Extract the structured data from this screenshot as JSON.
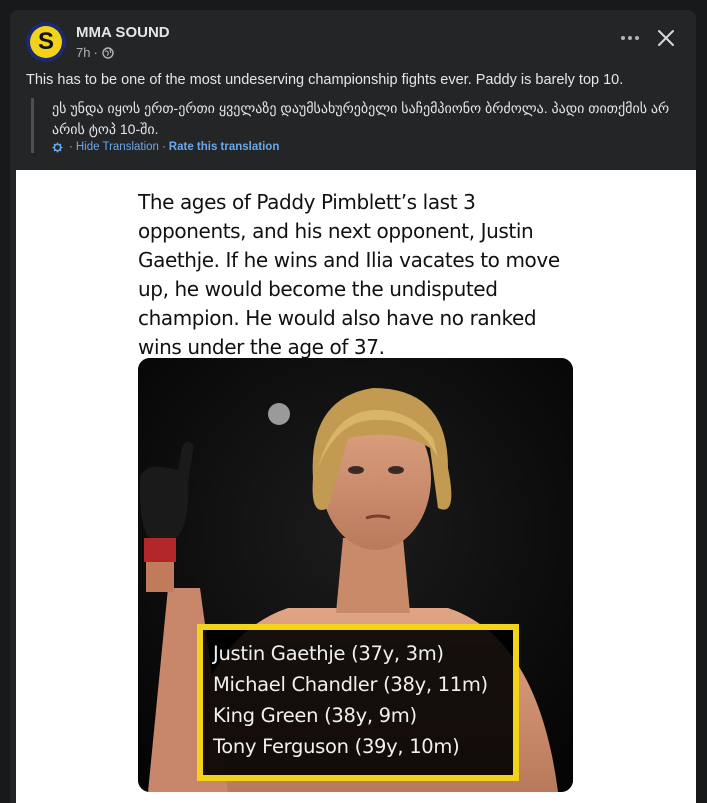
{
  "post": {
    "page_name": "MMA SOUND",
    "avatar_letter": "S",
    "time": "7h",
    "time_separator": "·",
    "more_label": "•••",
    "text": "This has to be one of the most undeserving championship fights ever. Paddy is barely top 10.",
    "translation": {
      "text": "ეს უნდა იყოს ერთ-ერთი ყველაზე დაუმსახურებელი საჩემპიონო ბრძოლა. პადი თითქმის არ არის ტოპ 10-ში.",
      "hide_label": "Hide Translation",
      "separator": "·",
      "rate_label": "Rate this translation"
    }
  },
  "image": {
    "tweet_text": "The ages of Paddy Pimblett’s last 3 opponents, and his next opponent, Justin Gaethje. If he wins and Ilia vacates to move up, he would become the undisputed champion. He would also have no ranked wins under the age of 37.",
    "opponents": [
      "Justin Gaethje (37y, 3m)",
      "Michael Chandler (38y, 11m)",
      "King Green (38y, 9m)",
      "Tony Ferguson (39y, 10m)"
    ],
    "list_border_color": "#f2d21b"
  },
  "colors": {
    "background": "#18191a",
    "card": "#242526",
    "link": "#6aa8ec",
    "avatar_yellow": "#f2d21b"
  }
}
